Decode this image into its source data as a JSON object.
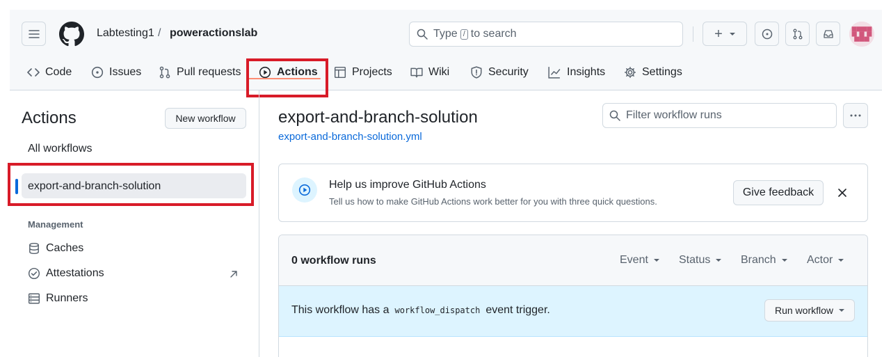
{
  "header": {
    "owner": "Labtesting1",
    "separator": "/",
    "repo": "poweractionslab",
    "search_placeholder_prefix": "Type",
    "search_kbd": "/",
    "search_placeholder_suffix": "to search",
    "plus_label": "+"
  },
  "tabs": [
    {
      "label": "Code",
      "icon": "code-icon"
    },
    {
      "label": "Issues",
      "icon": "issue-opened-icon"
    },
    {
      "label": "Pull requests",
      "icon": "git-pull-request-icon"
    },
    {
      "label": "Actions",
      "icon": "play-icon",
      "active": true
    },
    {
      "label": "Projects",
      "icon": "table-icon"
    },
    {
      "label": "Wiki",
      "icon": "book-icon"
    },
    {
      "label": "Security",
      "icon": "shield-icon"
    },
    {
      "label": "Insights",
      "icon": "graph-icon"
    },
    {
      "label": "Settings",
      "icon": "gear-icon"
    }
  ],
  "sidebar": {
    "title": "Actions",
    "new_workflow": "New workflow",
    "all_workflows": "All workflows",
    "selected_workflow": "export-and-branch-solution",
    "management_label": "Management",
    "management_items": [
      {
        "label": "Caches",
        "icon": "database-icon"
      },
      {
        "label": "Attestations",
        "icon": "verified-icon"
      },
      {
        "label": "Runners",
        "icon": "server-icon"
      }
    ]
  },
  "main": {
    "title": "export-and-branch-solution",
    "file": "export-and-branch-solution.yml",
    "filter_placeholder": "Filter workflow runs",
    "banner": {
      "title": "Help us improve GitHub Actions",
      "subtitle": "Tell us how to make GitHub Actions work better for you with three quick questions.",
      "button": "Give feedback"
    },
    "runs": {
      "count_label": "0 workflow runs",
      "filters": [
        "Event",
        "Status",
        "Branch",
        "Actor"
      ]
    },
    "dispatch": {
      "prefix": "This workflow has a",
      "code": "workflow_dispatch",
      "suffix": "event trigger.",
      "button": "Run workflow"
    }
  },
  "colors": {
    "highlight_box": "#d81b28",
    "active_tab_underline": "#fd8c73",
    "link": "#0969da",
    "dispatch_bg": "#ddf4ff"
  }
}
